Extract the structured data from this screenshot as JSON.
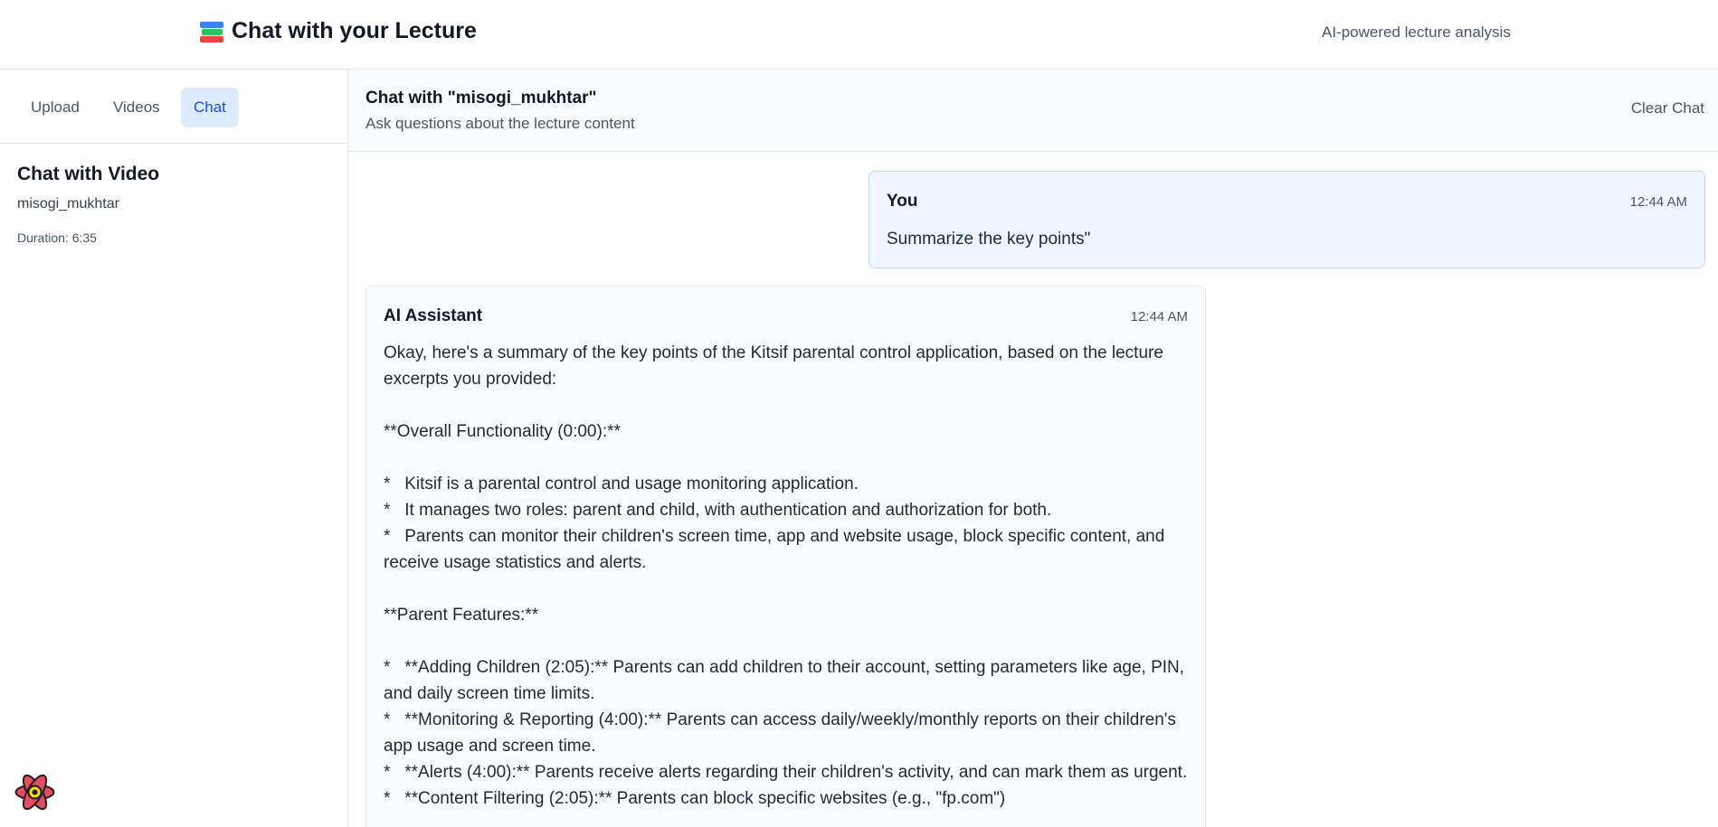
{
  "header": {
    "title": "Chat with your Lecture",
    "icon": "books-icon",
    "tagline": "AI-powered lecture analysis"
  },
  "sidebar": {
    "tabs": [
      {
        "label": "Upload",
        "active": false
      },
      {
        "label": "Videos",
        "active": false
      },
      {
        "label": "Chat",
        "active": true
      }
    ],
    "heading": "Chat with Video",
    "video_name": "misogi_mukhtar",
    "duration": "Duration: 6:35"
  },
  "chat": {
    "title": "Chat with \"misogi_mukhtar\"",
    "subtitle": "Ask questions about the lecture content",
    "clear_label": "Clear Chat",
    "messages": [
      {
        "author": "You",
        "time": "12:44 AM",
        "text": "Summarize the key points\""
      },
      {
        "author": "AI Assistant",
        "time": "12:44 AM",
        "text": "Okay, here's a summary of the key points of the Kitsif parental control application, based on the lecture excerpts you provided:\n\n**Overall Functionality (0:00):**\n\n*   Kitsif is a parental control and usage monitoring application.\n*   It manages two roles: parent and child, with authentication and authorization for both.\n*   Parents can monitor their children's screen time, app and website usage, block specific content, and receive usage statistics and alerts.\n\n**Parent Features:**\n\n*   **Adding Children (2:05):** Parents can add children to their account, setting parameters like age, PIN, and daily screen time limits.\n*   **Monitoring & Reporting (4:00):** Parents can access daily/weekly/monthly reports on their children's app usage and screen time.\n*   **Alerts (4:00):** Parents receive alerts regarding their children's activity, and can mark them as urgent.\n*   **Content Filtering (2:05):** Parents can block specific websites (e.g., \"fp.com\")"
      }
    ]
  },
  "colors": {
    "accent": "#1d4ed8",
    "active_tab_bg": "#dbeafe",
    "user_bubble_bg": "#eff6ff",
    "user_bubble_border": "#bfdbfe",
    "ai_bubble_bg": "#f9fafb"
  }
}
